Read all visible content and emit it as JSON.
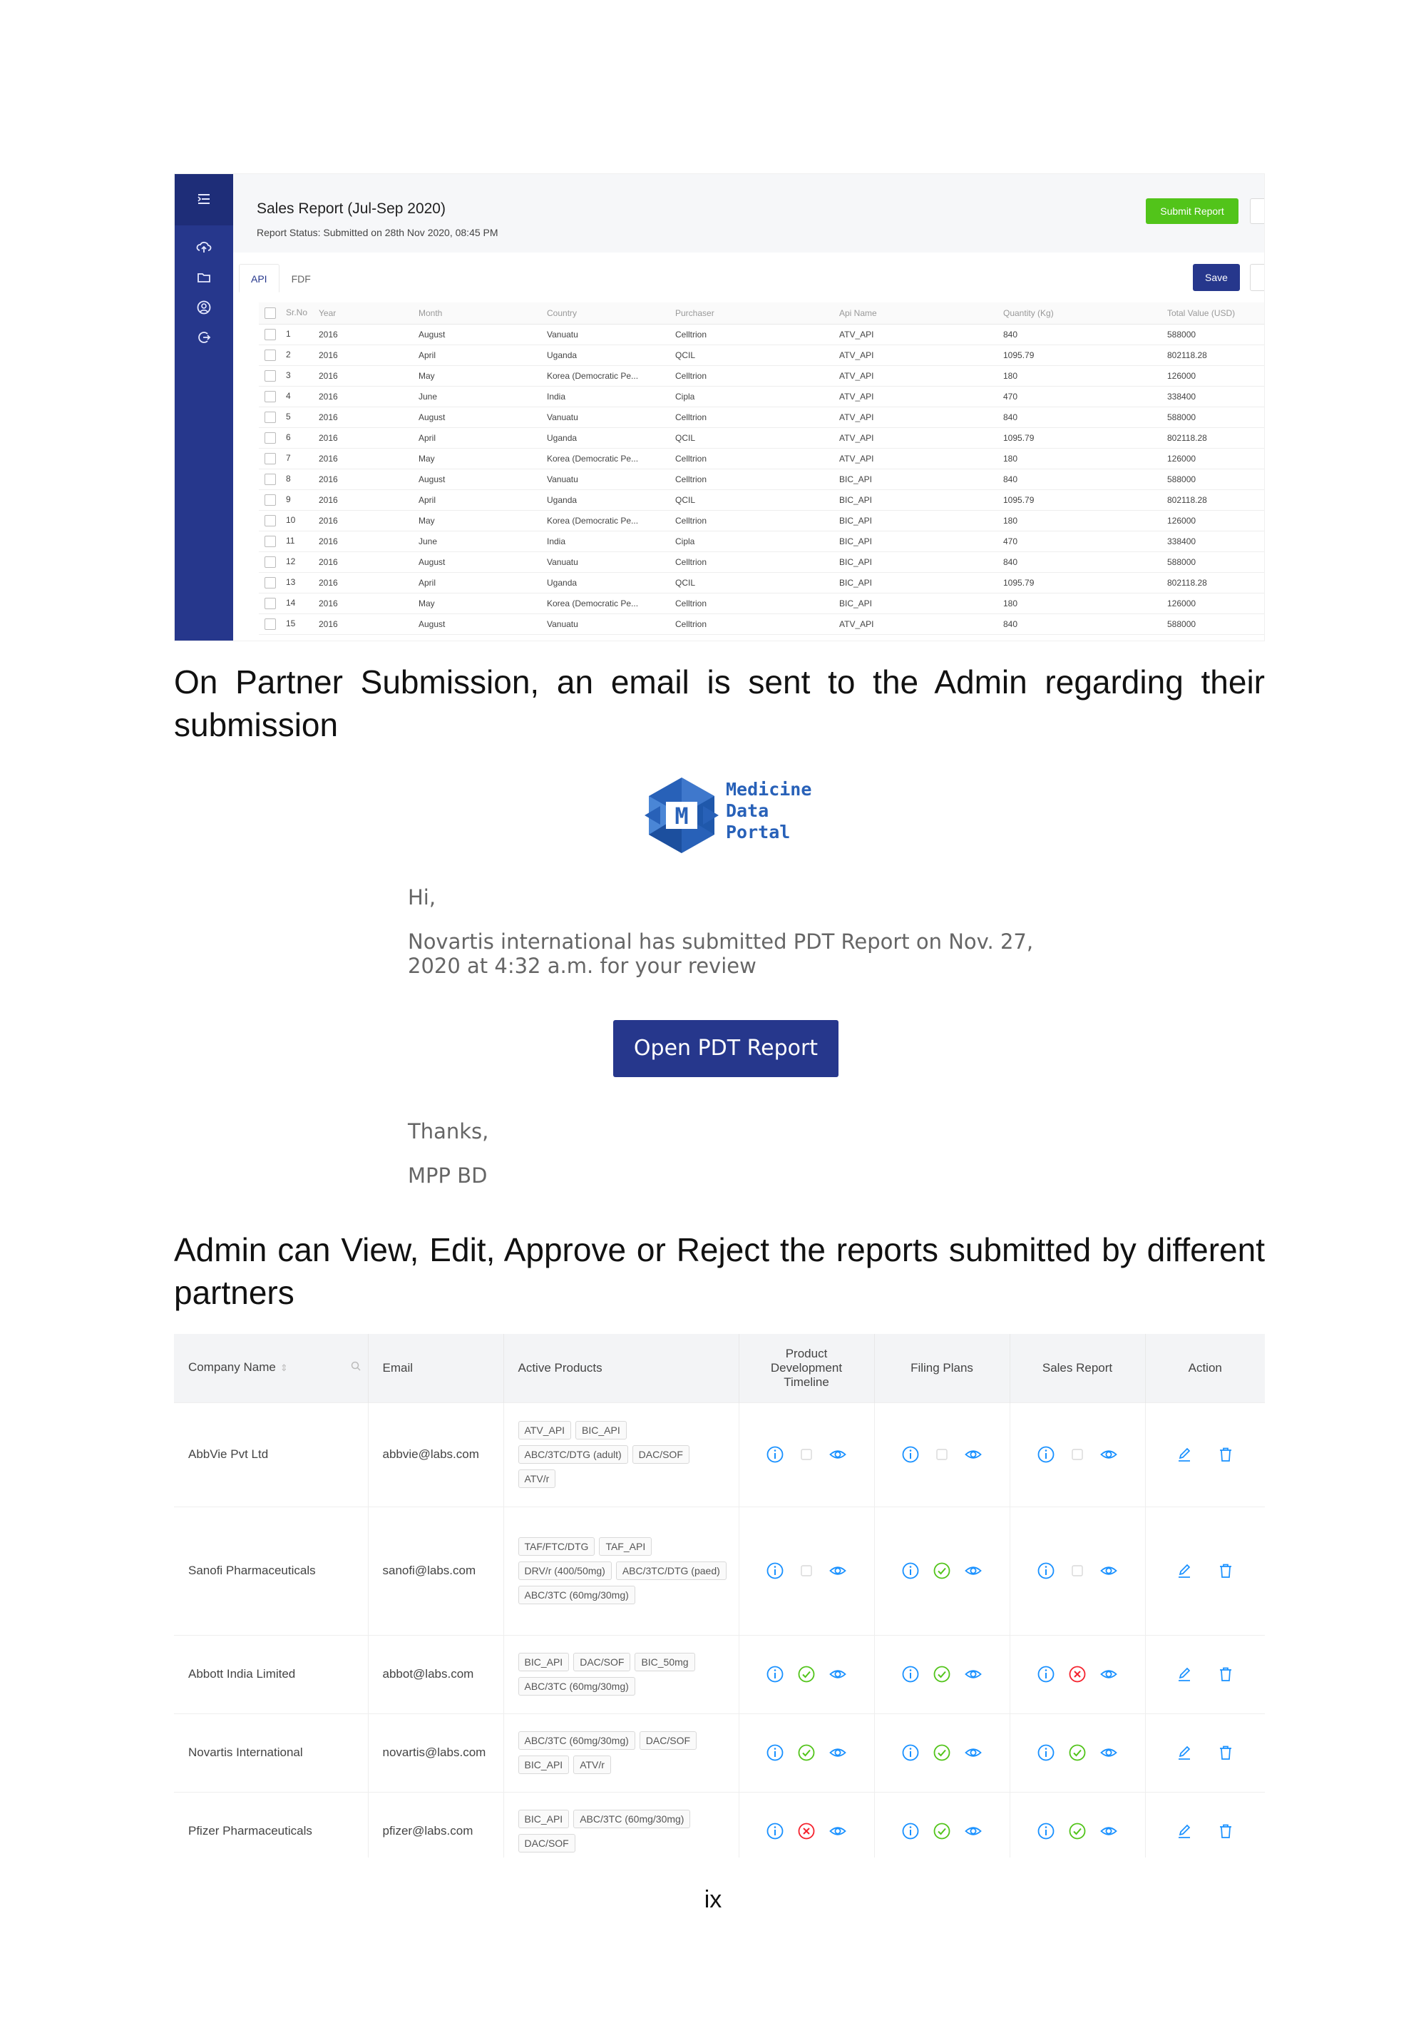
{
  "sales_screenshot": {
    "title": "Sales Report (Jul-Sep 2020)",
    "status": "Report Status:  Submitted on 28th Nov 2020, 08:45 PM",
    "submit_label": "Submit Report",
    "tabs": [
      "API",
      "FDF"
    ],
    "save_label": "Save",
    "columns": [
      "Sr.No",
      "Year",
      "Month",
      "Country",
      "Purchaser",
      "Api Name",
      "Quantity (Kg)",
      "Total Value (USD)"
    ],
    "rows": [
      [
        "1",
        "2016",
        "August",
        "Vanuatu",
        "Celltrion",
        "ATV_API",
        "840",
        "588000"
      ],
      [
        "2",
        "2016",
        "April",
        "Uganda",
        "QCIL",
        "ATV_API",
        "1095.79",
        "802118.28"
      ],
      [
        "3",
        "2016",
        "May",
        "Korea (Democratic Pe...",
        "Celltrion",
        "ATV_API",
        "180",
        "126000"
      ],
      [
        "4",
        "2016",
        "June",
        "India",
        "Cipla",
        "ATV_API",
        "470",
        "338400"
      ],
      [
        "5",
        "2016",
        "August",
        "Vanuatu",
        "Celltrion",
        "ATV_API",
        "840",
        "588000"
      ],
      [
        "6",
        "2016",
        "April",
        "Uganda",
        "QCIL",
        "ATV_API",
        "1095.79",
        "802118.28"
      ],
      [
        "7",
        "2016",
        "May",
        "Korea (Democratic Pe...",
        "Celltrion",
        "ATV_API",
        "180",
        "126000"
      ],
      [
        "8",
        "2016",
        "August",
        "Vanuatu",
        "Celltrion",
        "BIC_API",
        "840",
        "588000"
      ],
      [
        "9",
        "2016",
        "April",
        "Uganda",
        "QCIL",
        "BIC_API",
        "1095.79",
        "802118.28"
      ],
      [
        "10",
        "2016",
        "May",
        "Korea (Democratic Pe...",
        "Celltrion",
        "BIC_API",
        "180",
        "126000"
      ],
      [
        "11",
        "2016",
        "June",
        "India",
        "Cipla",
        "BIC_API",
        "470",
        "338400"
      ],
      [
        "12",
        "2016",
        "August",
        "Vanuatu",
        "Celltrion",
        "BIC_API",
        "840",
        "588000"
      ],
      [
        "13",
        "2016",
        "April",
        "Uganda",
        "QCIL",
        "BIC_API",
        "1095.79",
        "802118.28"
      ],
      [
        "14",
        "2016",
        "May",
        "Korea (Democratic Pe...",
        "Celltrion",
        "BIC_API",
        "180",
        "126000"
      ],
      [
        "15",
        "2016",
        "August",
        "Vanuatu",
        "Celltrion",
        "ATV_API",
        "840",
        "588000"
      ]
    ]
  },
  "para1": "On Partner Submission, an email is sent to the Admin regarding their submission",
  "email": {
    "logo_letter": "M",
    "logo_line1": "Medicine",
    "logo_line2": "Data",
    "logo_line3": "Portal",
    "greeting": "Hi,",
    "body_line1": "Novartis international has submitted PDT Report on Nov. 27,",
    "body_line2": "2020 at 4:32 a.m. for your review",
    "button": "Open PDT Report",
    "thanks": "Thanks,",
    "signature": "MPP BD"
  },
  "para2": "Admin can View, Edit, Approve or Reject the reports submitted by different partners",
  "admin_table": {
    "headers": [
      "Company Name",
      "Email",
      "Active Products",
      "Product Development Timeline",
      "Filing Plans",
      "Sales Report",
      "Action"
    ],
    "rows": [
      {
        "company": "AbbVie Pvt Ltd",
        "email": "abbvie@labs.com",
        "products": [
          "ATV_API",
          "BIC_API",
          "ABC/3TC/DTG (adult)",
          "DAC/SOF",
          "ATV/r"
        ],
        "pdt": "empty",
        "filing": "empty",
        "sales": "empty"
      },
      {
        "company": "Sanofi Pharmaceuticals",
        "email": "sanofi@labs.com",
        "products": [
          "TAF/FTC/DTG",
          "TAF_API",
          "DRV/r (400/50mg)",
          "ABC/3TC/DTG (paed)",
          "ABC/3TC (60mg/30mg)"
        ],
        "pdt": "empty",
        "filing": "approved",
        "sales": "empty"
      },
      {
        "company": "Abbott India Limited",
        "email": "abbot@labs.com",
        "products": [
          "BIC_API",
          "DAC/SOF",
          "BIC_50mg",
          "ABC/3TC (60mg/30mg)"
        ],
        "pdt": "approved",
        "filing": "approved",
        "sales": "rejected"
      },
      {
        "company": "Novartis International",
        "email": "novartis@labs.com",
        "products": [
          "ABC/3TC (60mg/30mg)",
          "DAC/SOF",
          "BIC_API",
          "ATV/r"
        ],
        "pdt": "approved",
        "filing": "approved",
        "sales": "approved"
      },
      {
        "company": "Pfizer Pharmaceuticals",
        "email": "pfizer@labs.com",
        "products": [
          "BIC_API",
          "ABC/3TC (60mg/30mg)",
          "DAC/SOF"
        ],
        "pdt": "rejected",
        "filing": "approved",
        "sales": "approved"
      }
    ],
    "colors": {
      "info": "#1890ff",
      "approved": "#52c41a",
      "rejected": "#f5222d",
      "empty": "#d9d9d9",
      "action": "#1890ff"
    }
  },
  "page_number": "ix"
}
